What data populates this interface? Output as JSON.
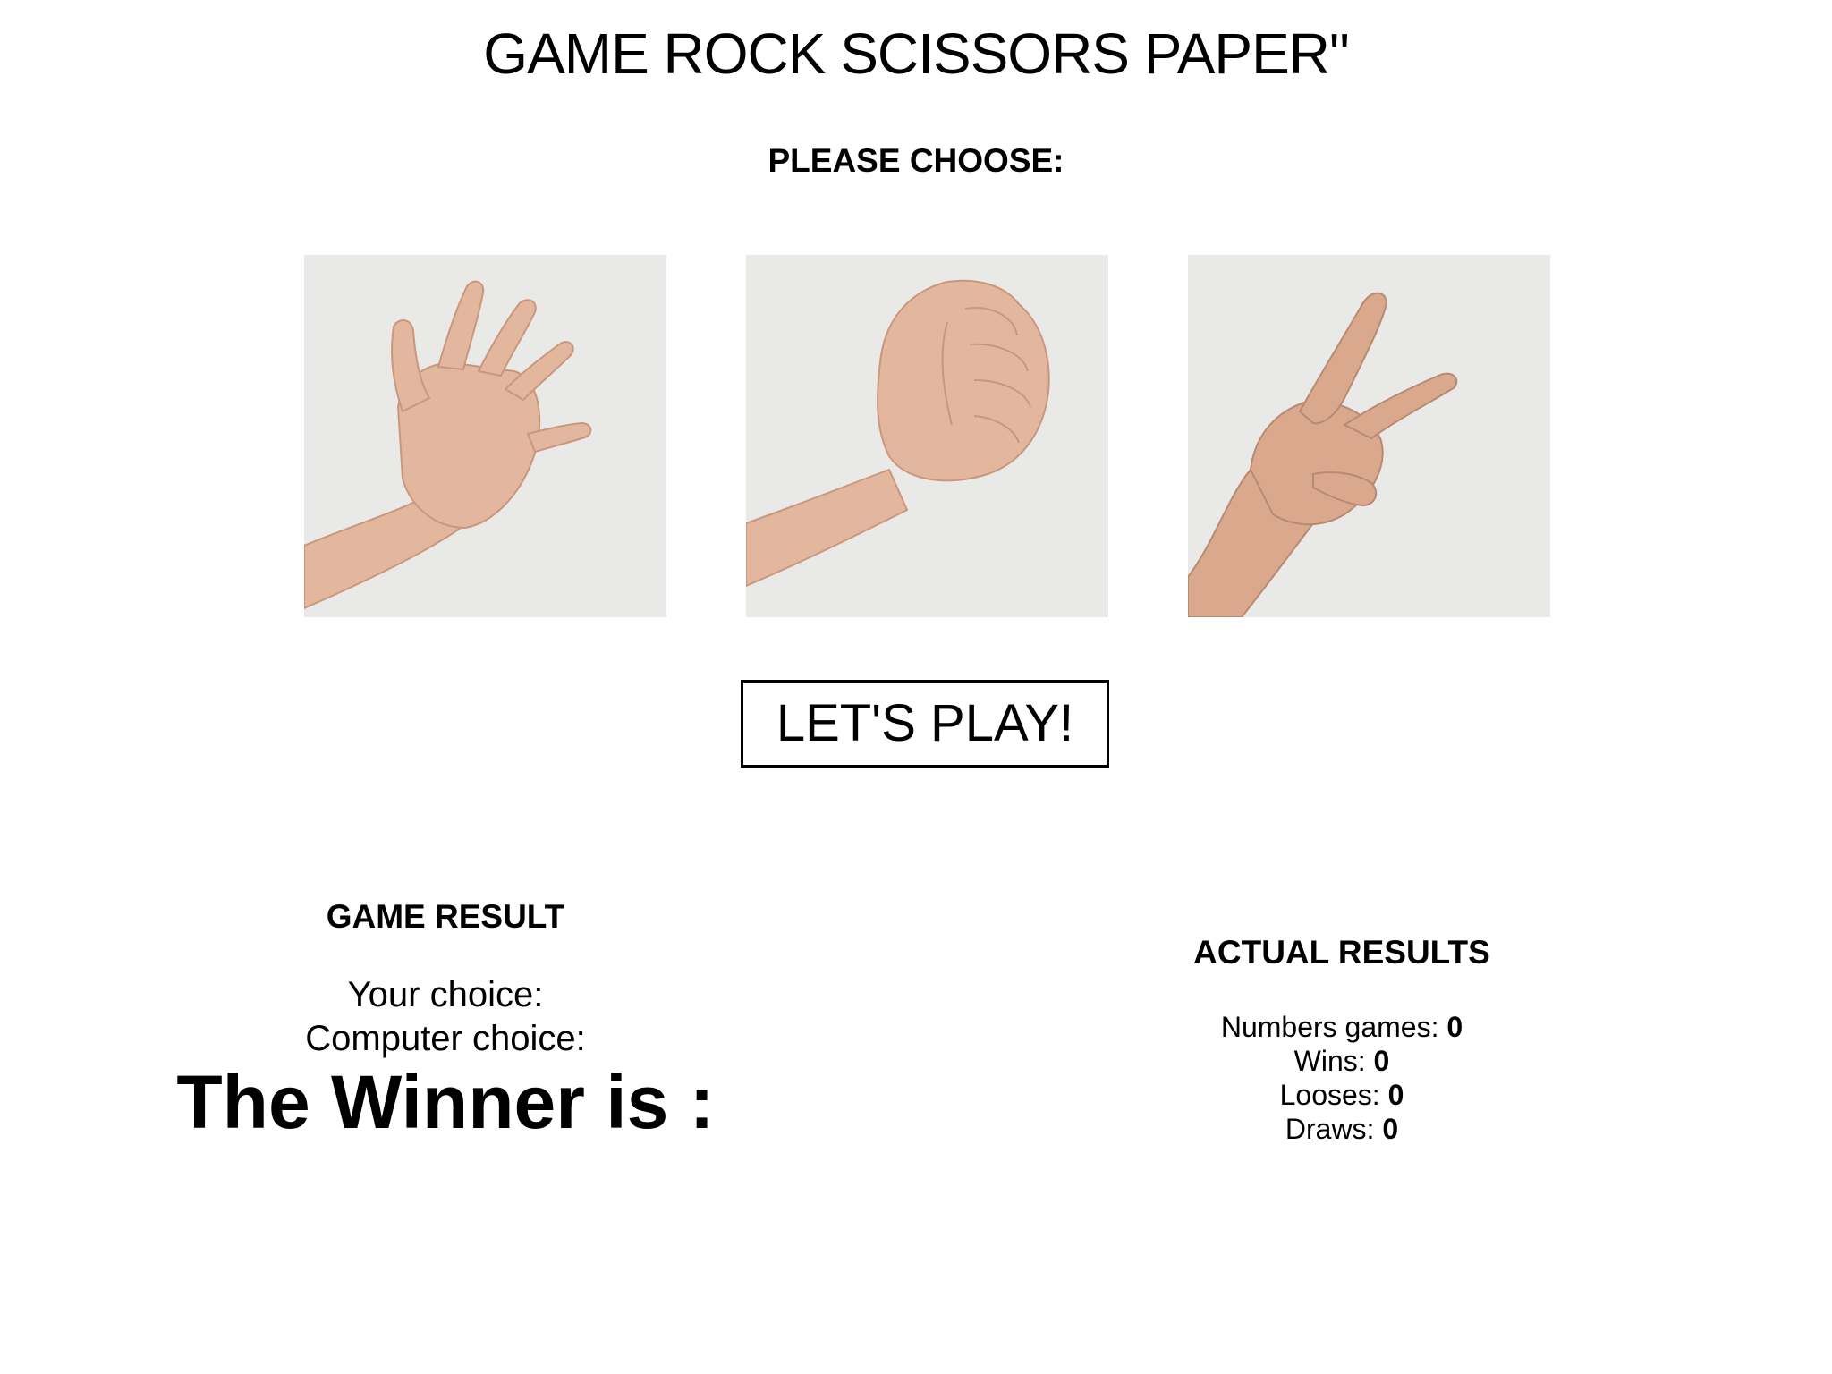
{
  "header": {
    "title": "GAME ROCK SCISSORS PAPER\"",
    "prompt": "PLEASE CHOOSE:"
  },
  "choices": [
    {
      "name": "paper",
      "image": "open-hand-icon"
    },
    {
      "name": "rock",
      "image": "fist-icon"
    },
    {
      "name": "scissors",
      "image": "peace-sign-hand-icon"
    }
  ],
  "play_button": {
    "label": "LET'S PLAY!"
  },
  "game_result": {
    "heading": "GAME RESULT",
    "your_choice_label": "Your choice:",
    "computer_choice_label": "Computer choice:",
    "winner_label": "The Winner is :"
  },
  "actual_results": {
    "heading": "ACTUAL RESULTS",
    "numbers_games_label": "Numbers games:",
    "numbers_games_value": "0",
    "wins_label": "Wins:",
    "wins_value": "0",
    "looses_label": "Looses:",
    "looses_value": "0",
    "draws_label": "Draws:",
    "draws_value": "0"
  },
  "colors": {
    "background": "#ffffff",
    "text": "#000000",
    "photo_background": "#e9e9e7",
    "skin": "#e6b9a0"
  }
}
